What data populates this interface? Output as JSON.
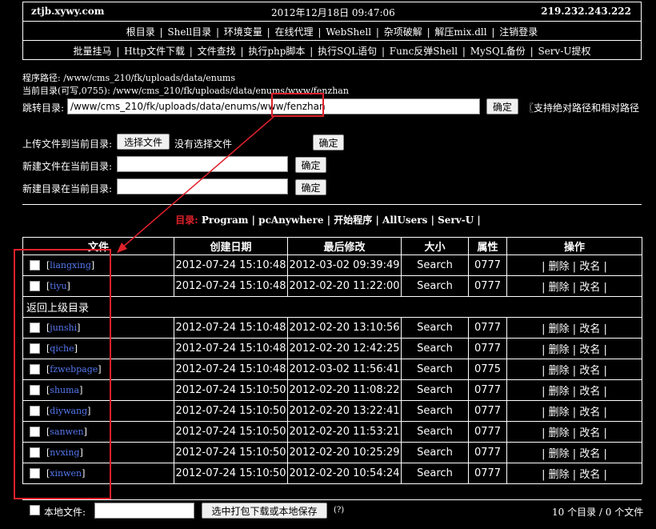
{
  "header": {
    "host": "ztjb.xywy.com",
    "datetime": "2012年12月18日 09:47:06",
    "ip": "219.232.243.222",
    "nav1": [
      "根目录",
      "Shell目录",
      "环境变量",
      "在线代理",
      "WebShell",
      "杂项破解",
      "解压mix.dll",
      "注销登录"
    ],
    "nav2": [
      "批量挂马",
      "Http文件下载",
      "文件查找",
      "执行php脚本",
      "执行SQL语句",
      "Func反弹Shell",
      "MySQL备份",
      "Serv-U提权"
    ]
  },
  "info": {
    "program_path": "程序路径: /www/cms_210/fk/uploads/data/enums",
    "current_dir": "当前目录(可写,0755): /www/cms_210/fk/uploads/data/enums/www/fenzhan",
    "jump_label": "跳转目录:",
    "jump_value": "/www/cms_210/fk/uploads/data/enums/www/fenzhan",
    "jump_ok": "确定",
    "jump_hint": "〖支持绝对路径和相对路径",
    "upload_label": "上传文件到当前目录:",
    "choose_file": "选择文件",
    "no_file": "没有选择文件",
    "upload_ok": "确定",
    "newfile_label": "新建文件在当前目录:",
    "newfile_ok": "确定",
    "newdir_label": "新建目录在当前目录:",
    "newdir_ok": "确定"
  },
  "menu": {
    "prefix": "目录:",
    "items": [
      "Program",
      "pcAnywhere",
      "开始程序",
      "AllUsers",
      "Serv-U"
    ]
  },
  "table": {
    "headers": [
      "文件",
      "创建日期",
      "最后修改",
      "大小",
      "属性",
      "操作"
    ],
    "go_up": "返回上级目录",
    "op_delete": "删除",
    "op_rename": "改名",
    "rows_top": [
      {
        "name": "liangxing",
        "created": "2012-07-24 15:10:48",
        "modified": "2012-03-02 09:39:49",
        "size": "Search",
        "attr": "0777"
      },
      {
        "name": "tiyu",
        "created": "2012-07-24 15:10:48",
        "modified": "2012-02-20 11:22:00",
        "size": "Search",
        "attr": "0777"
      }
    ],
    "rows_bottom": [
      {
        "name": "junshi",
        "created": "2012-07-24 15:10:48",
        "modified": "2012-02-20 13:10:56",
        "size": "Search",
        "attr": "0777"
      },
      {
        "name": "qiche",
        "created": "2012-07-24 15:10:48",
        "modified": "2012-02-20 12:42:25",
        "size": "Search",
        "attr": "0777"
      },
      {
        "name": "fzwebpage",
        "created": "2012-07-24 15:10:48",
        "modified": "2012-03-02 11:56:41",
        "size": "Search",
        "attr": "0775"
      },
      {
        "name": "shuma",
        "created": "2012-07-24 15:10:50",
        "modified": "2012-02-20 11:08:22",
        "size": "Search",
        "attr": "0777"
      },
      {
        "name": "diywang",
        "created": "2012-07-24 15:10:50",
        "modified": "2012-02-20 13:22:41",
        "size": "Search",
        "attr": "0777"
      },
      {
        "name": "sanwen",
        "created": "2012-07-24 15:10:50",
        "modified": "2012-02-20 11:53:21",
        "size": "Search",
        "attr": "0777"
      },
      {
        "name": "nvxing",
        "created": "2012-07-24 15:10:50",
        "modified": "2012-02-20 10:25:29",
        "size": "Search",
        "attr": "0777"
      },
      {
        "name": "xinwen",
        "created": "2012-07-24 15:10:50",
        "modified": "2012-02-20 10:54:24",
        "size": "Search",
        "attr": "0777"
      }
    ]
  },
  "bottom": {
    "local_label": "本地文件:",
    "pack_button": "选中打包下载或本地保存",
    "help": "(?)",
    "summary": "10 个目录 / 0 个文件"
  },
  "colors": {
    "background": "#000000",
    "text": "#ffffff",
    "link_dir": "#5577ee",
    "annotation_red": "#e0212b"
  }
}
